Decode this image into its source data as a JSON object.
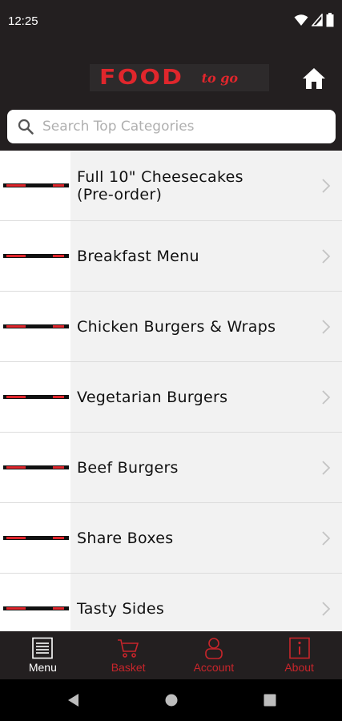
{
  "status_bar": {
    "time": "12:25"
  },
  "header": {
    "logo_main": "FOOD",
    "logo_sub": "to go"
  },
  "search": {
    "placeholder": "Search Top Categories",
    "value": ""
  },
  "categories": [
    {
      "label": "Full 10\" Cheesecakes\n(Pre-order)"
    },
    {
      "label": "Breakfast Menu"
    },
    {
      "label": "Chicken Burgers & Wraps"
    },
    {
      "label": "Vegetarian Burgers"
    },
    {
      "label": "Beef Burgers"
    },
    {
      "label": "Share Boxes"
    },
    {
      "label": "Tasty Sides"
    }
  ],
  "bottom_nav": [
    {
      "label": "Menu",
      "icon": "menu-icon",
      "active": true
    },
    {
      "label": "Basket",
      "icon": "basket-icon",
      "active": false
    },
    {
      "label": "Account",
      "icon": "account-icon",
      "active": false
    },
    {
      "label": "About",
      "icon": "info-icon",
      "active": false
    }
  ],
  "colors": {
    "brand_red": "#e0262c",
    "header_bg": "#231f20",
    "active_tab": "#ffffff",
    "inactive_tab": "#c8252b"
  }
}
